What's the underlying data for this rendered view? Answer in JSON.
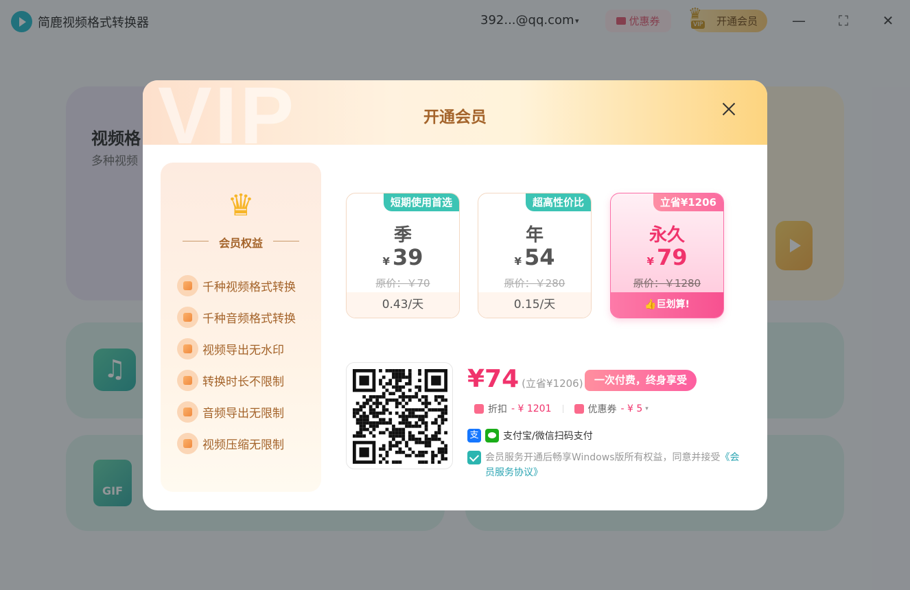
{
  "app": {
    "title": "简鹿视频格式转换器",
    "account": "392...@qq.com",
    "account_caret": "▾",
    "coupon_label": "优惠券",
    "vip_label": "开通会员",
    "vip_tag": "VIP",
    "win_controls": [
      "—",
      "⛶",
      "✕"
    ]
  },
  "background": {
    "card1_title": "视频格",
    "card1_sub": "多种视频",
    "gif_label": "GIF",
    "music_icon": "♫"
  },
  "modal": {
    "title": "开通会员",
    "watermark": "VIP",
    "benefits_title": "会员权益",
    "crown_icon": "♛",
    "benefits": [
      {
        "label": "千种视频格式转换",
        "icon": "video-convert-icon"
      },
      {
        "label": "千种音频格式转换",
        "icon": "audio-convert-icon"
      },
      {
        "label": "视频导出无水印",
        "icon": "no-watermark-icon"
      },
      {
        "label": "转换时长不限制",
        "icon": "clock-icon"
      },
      {
        "label": "音频导出无限制",
        "icon": "audio-export-icon"
      },
      {
        "label": "视频压缩无限制",
        "icon": "compress-icon"
      }
    ],
    "plans": [
      {
        "badge": "短期使用首选",
        "name": "季",
        "currency": "¥",
        "price": "39",
        "original": "原价：￥70",
        "footer": "0.43/天",
        "badge_color": "#3cc4b4"
      },
      {
        "badge": "超高性价比",
        "name": "年",
        "currency": "¥",
        "price": "54",
        "original": "原价：￥280",
        "footer": "0.15/天",
        "badge_color": "#3cc4b4"
      },
      {
        "badge": "立省¥1206",
        "name": "永久",
        "currency": "¥",
        "price": "79",
        "original": "原价：￥1280",
        "footer": "👍巨划算!",
        "badge_color": "#fb6aa0"
      }
    ],
    "pay": {
      "amount": "¥74",
      "save": "(立省¥1206)",
      "tag": "一次付费，终身享受",
      "discount_label": "折扣",
      "discount_value": "- ¥ 1201",
      "coupon_label": "优惠券",
      "coupon_value": "- ¥ 5",
      "coupon_caret": "▾",
      "alipay_glyph": "支",
      "method_text": "支付宝/微信扫码支付",
      "agree_text": "会员服务开通后畅享Windows版所有权益，同意并接受",
      "agree_link": "《会员服务协议》"
    }
  }
}
